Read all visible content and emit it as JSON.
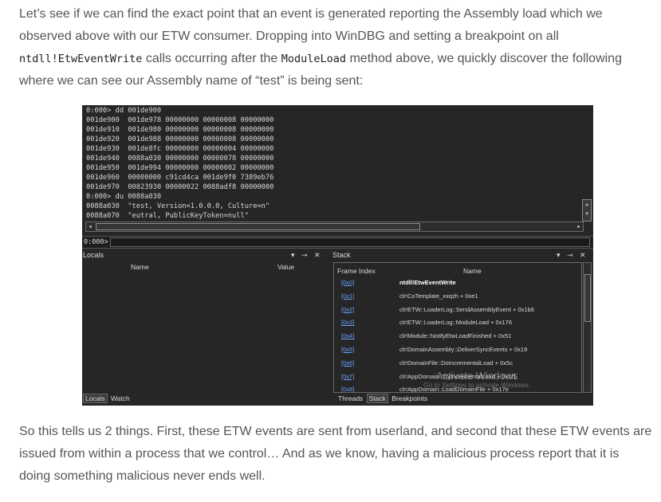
{
  "article": {
    "p1": {
      "a": "Let’s see if we can find the exact point that an event is generated reporting the Assembly load which we observed above with our ETW consumer. Dropping into WinDBG and setting a breakpoint on all ",
      "code1": "ntdll!EtwEventWrite",
      "b": " calls occurring after the ",
      "code2": "ModuleLoad",
      "c": " method above, we quickly discover the following where we can see our Assembly name of “test” is being sent:"
    },
    "p2": "So this tells us 2 things. First, these ETW events are sent from userland, and second that these ETW events are issued from within a process that we control… And as we know, having a malicious process report that it is doing something malicious never ends well."
  },
  "windbg": {
    "output_lines": [
      "0:000> dd 001de900",
      "001de900  001de978 00000000 00000008 00000000",
      "001de910  001de980 00000000 00000008 00000000",
      "001de920  001de988 00000000 00000008 00000000",
      "001de930  001de8fc 00000000 00000004 00000000",
      "001de940  0088a030 00000000 00000078 00000000",
      "001de950  001de994 00000000 00000002 00000000",
      "001de960  00000000 c91cd4ca 001de9f0 7389eb76",
      "001de970  00823930 00000022 0088adf8 00000000",
      "0:000> du 0088a030",
      "0088a030  \"test, Version=1.0.0.0, Culture=n\"",
      "0088a070  \"eutral, PublicKeyToken=null\""
    ],
    "prompt": "0:000>",
    "locals": {
      "title": "Locals",
      "controls": "▾ ⊸ ✕",
      "col_name": "Name",
      "col_value": "Value",
      "tabs": [
        "Locals",
        "Watch"
      ]
    },
    "stack": {
      "title": "Stack",
      "controls": "▾ ⊸ ✕",
      "col_frame": "Frame Index",
      "col_name": "Name",
      "frames": [
        {
          "index": "[0x0]",
          "name": "ntdll!EtwEventWrite"
        },
        {
          "index": "[0x1]",
          "name": "clr!CoTemplate_xxqzh + 0xe1"
        },
        {
          "index": "[0x2]",
          "name": "clr!ETW::LoaderLog::SendAssemblyEvent + 0x1b6"
        },
        {
          "index": "[0x3]",
          "name": "clr!ETW::LoaderLog::ModuleLoad + 0x176"
        },
        {
          "index": "[0x4]",
          "name": "clr!Module::NotifyEtwLoadFinished + 0x51"
        },
        {
          "index": "[0x5]",
          "name": "clr!DomainAssembly::DeliverSyncEvents + 0x19"
        },
        {
          "index": "[0x6]",
          "name": "clr!DomainFile::DoIncrementalLoad + 0x5c"
        },
        {
          "index": "[0x7]",
          "name": "clr!AppDomain::TryIncrementalLoad + 0x1f1"
        },
        {
          "index": "[0x8]",
          "name": "clr!AppDomain::LoadDomainFile + 0x17e"
        }
      ],
      "tabs": [
        "Threads",
        "Stack",
        "Breakpoints"
      ]
    },
    "watermark": "Activate Windows",
    "watermark_sub": "Go to Settings to activate Windows."
  }
}
